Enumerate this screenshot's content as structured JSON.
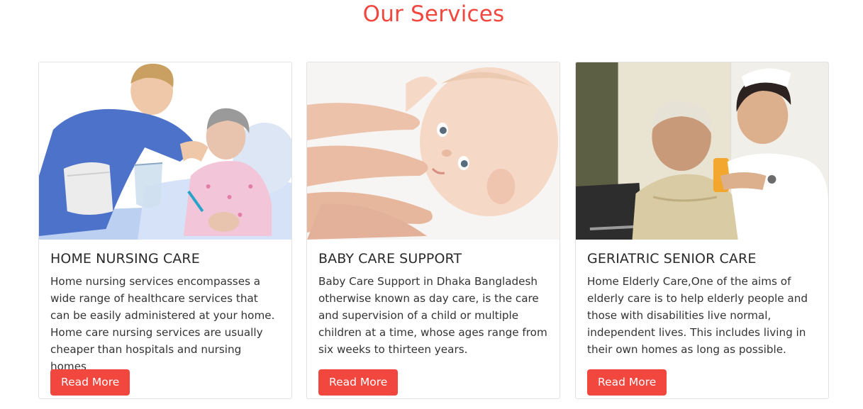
{
  "section": {
    "title": "Our Services"
  },
  "colors": {
    "accent": "#f2473f",
    "card_border": "#e2e2e2"
  },
  "cards": [
    {
      "image_subject": "nurse serving water to elderly woman in bed",
      "title": "HOME NURSING CARE",
      "text": "Home nursing services encompasses a wide range of healthcare services that can be easily administered at your home. Home care nursing services are usually cheaper than hospitals and nursing homes",
      "button_label": "Read More"
    },
    {
      "image_subject": "baby receiving gentle massage",
      "title": "BABY CARE SUPPORT",
      "text": "Baby Care Support in Dhaka Bangladesh otherwise known as day care, is the care and supervision of a child or multiple children at a time, whose ages range from six weeks to thirteen years.",
      "button_label": "Read More"
    },
    {
      "image_subject": "nurse helping elderly woman drink juice",
      "title": "GERIATRIC SENIOR CARE",
      "text": "Home Elderly Care,One of the aims of elderly care is to help elderly people and those with disabilities live normal, independent lives. This includes living in their own homes as long as possible.",
      "button_label": "Read More"
    }
  ]
}
